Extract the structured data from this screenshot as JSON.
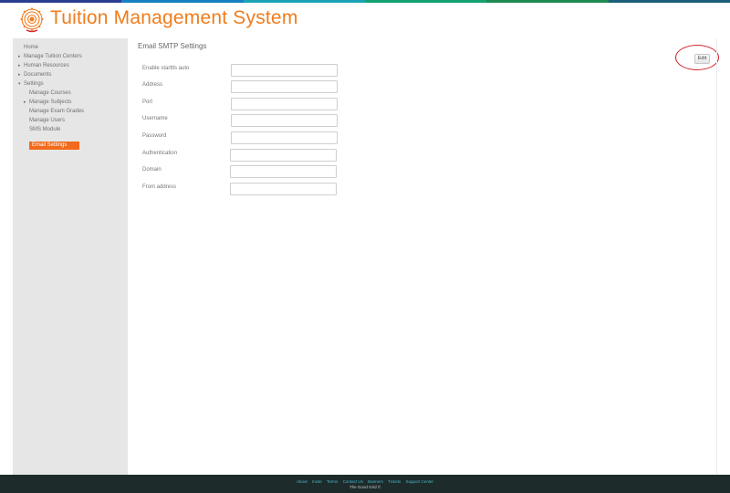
{
  "header": {
    "title": "Tuition Management System",
    "logo_icon": "gear-logo-icon"
  },
  "topbar_colors": [
    "#2b3d8f",
    "#1581c4",
    "#18a3b6",
    "#14a070",
    "#1e8a52",
    "#1a5e7a"
  ],
  "sidebar": {
    "items": [
      {
        "label": "Home",
        "arrow": ""
      },
      {
        "label": "Manage Tuition Centers",
        "arrow": "▸"
      },
      {
        "label": "Human Resources",
        "arrow": "▸"
      },
      {
        "label": "Documents",
        "arrow": "▸"
      },
      {
        "label": "Settings",
        "arrow": "▾"
      },
      {
        "label": "Manage Courses",
        "arrow": ""
      },
      {
        "label": "Manage Subjects",
        "arrow": "▸"
      },
      {
        "label": "Manage Exam Grades",
        "arrow": ""
      },
      {
        "label": "Manage Users",
        "arrow": ""
      },
      {
        "label": "SMS Module",
        "arrow": ""
      }
    ],
    "active_item": "Email Settings"
  },
  "main": {
    "heading": "Email SMTP Settings",
    "edit_label": "Edit",
    "fields": [
      {
        "label": "Enable starttls auto",
        "value": ""
      },
      {
        "label": "Address",
        "value": ""
      },
      {
        "label": "Port",
        "value": ""
      },
      {
        "label": "Username",
        "value": ""
      },
      {
        "label": "Password",
        "value": ""
      },
      {
        "label": "Authentication",
        "value": ""
      },
      {
        "label": "Domain",
        "value": ""
      },
      {
        "label": "From address",
        "value": ""
      }
    ]
  },
  "footer": {
    "links": [
      "About",
      "Invite",
      "Terms",
      "Contact Us",
      "Banners",
      "Tickets",
      "Support Center"
    ],
    "copyright": "The Good Grid ©"
  }
}
